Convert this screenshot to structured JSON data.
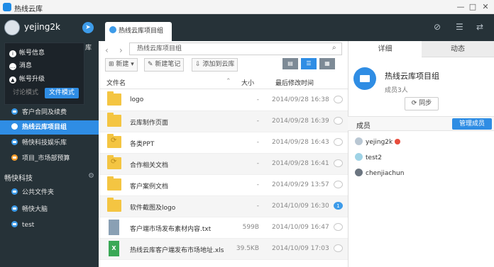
{
  "window": {
    "title": "热线云库"
  },
  "user": {
    "name": "yejing2k"
  },
  "account_menu": {
    "items": [
      {
        "label": "帐号信息",
        "icon": "info-icon"
      },
      {
        "label": "消息",
        "icon": "message-icon"
      },
      {
        "label": "帐号升级",
        "icon": "upgrade-icon"
      }
    ],
    "mode_discuss": "讨论模式",
    "mode_file": "文件模式"
  },
  "sidebar": {
    "partial_label": "库",
    "items": [
      {
        "label": "客户合同及续费"
      },
      {
        "label": "热线云库项目组"
      },
      {
        "label": "畅快科技娱乐库"
      },
      {
        "label": "项目_市场部预算"
      }
    ],
    "group": "畅快科技",
    "group_items": [
      {
        "label": "公共文件夹"
      },
      {
        "label": "畅快大脑"
      },
      {
        "label": "test"
      }
    ]
  },
  "tab": {
    "label": "热线云库项目组"
  },
  "address": {
    "path": "热线云库项目组"
  },
  "toolbar": {
    "new": "新建",
    "new_note": "新建笔记",
    "add_to_lib": "添加到云库"
  },
  "table": {
    "headers": {
      "name": "文件名",
      "size": "大小",
      "date": "最后修改时间"
    },
    "rows": [
      {
        "name": "logo",
        "size": "-",
        "date": "2014/09/28 16:38",
        "icon": "folder",
        "comments": ""
      },
      {
        "name": "云库制作页面",
        "size": "-",
        "date": "2014/09/28 16:39",
        "icon": "folder",
        "comments": ""
      },
      {
        "name": "各类PPT",
        "size": "-",
        "date": "2014/09/28 16:43",
        "icon": "sync-folder",
        "comments": ""
      },
      {
        "name": "合作相关文档",
        "size": "-",
        "date": "2014/09/28 16:41",
        "icon": "sync-folder",
        "comments": ""
      },
      {
        "name": "客户案例文档",
        "size": "-",
        "date": "2014/09/29 13:57",
        "icon": "folder",
        "comments": ""
      },
      {
        "name": "软件截图及logo",
        "size": "-",
        "date": "2014/10/09 16:30",
        "icon": "folder",
        "comments": "1"
      },
      {
        "name": "客户端市场发布素材内容.txt",
        "size": "599B",
        "date": "2014/10/09 16:47",
        "icon": "text-file",
        "comments": ""
      },
      {
        "name": "热线云库客户端发布市场地址.xls",
        "size": "39.5KB",
        "date": "2014/10/09 17:03",
        "icon": "excel-file",
        "comments": ""
      }
    ]
  },
  "detail": {
    "tab_detail": "详细",
    "tab_activity": "动态",
    "group_name": "热线云库项目组",
    "member_count": "成员3人",
    "sync": "同步",
    "members_title": "成员",
    "manage": "管理成员",
    "members": [
      {
        "name": "yejing2k"
      },
      {
        "name": "test2"
      },
      {
        "name": "chenjiachun"
      }
    ]
  },
  "colors": {
    "accent": "#2f8de4",
    "sidebar": "#263238",
    "folder": "#f4c542"
  }
}
